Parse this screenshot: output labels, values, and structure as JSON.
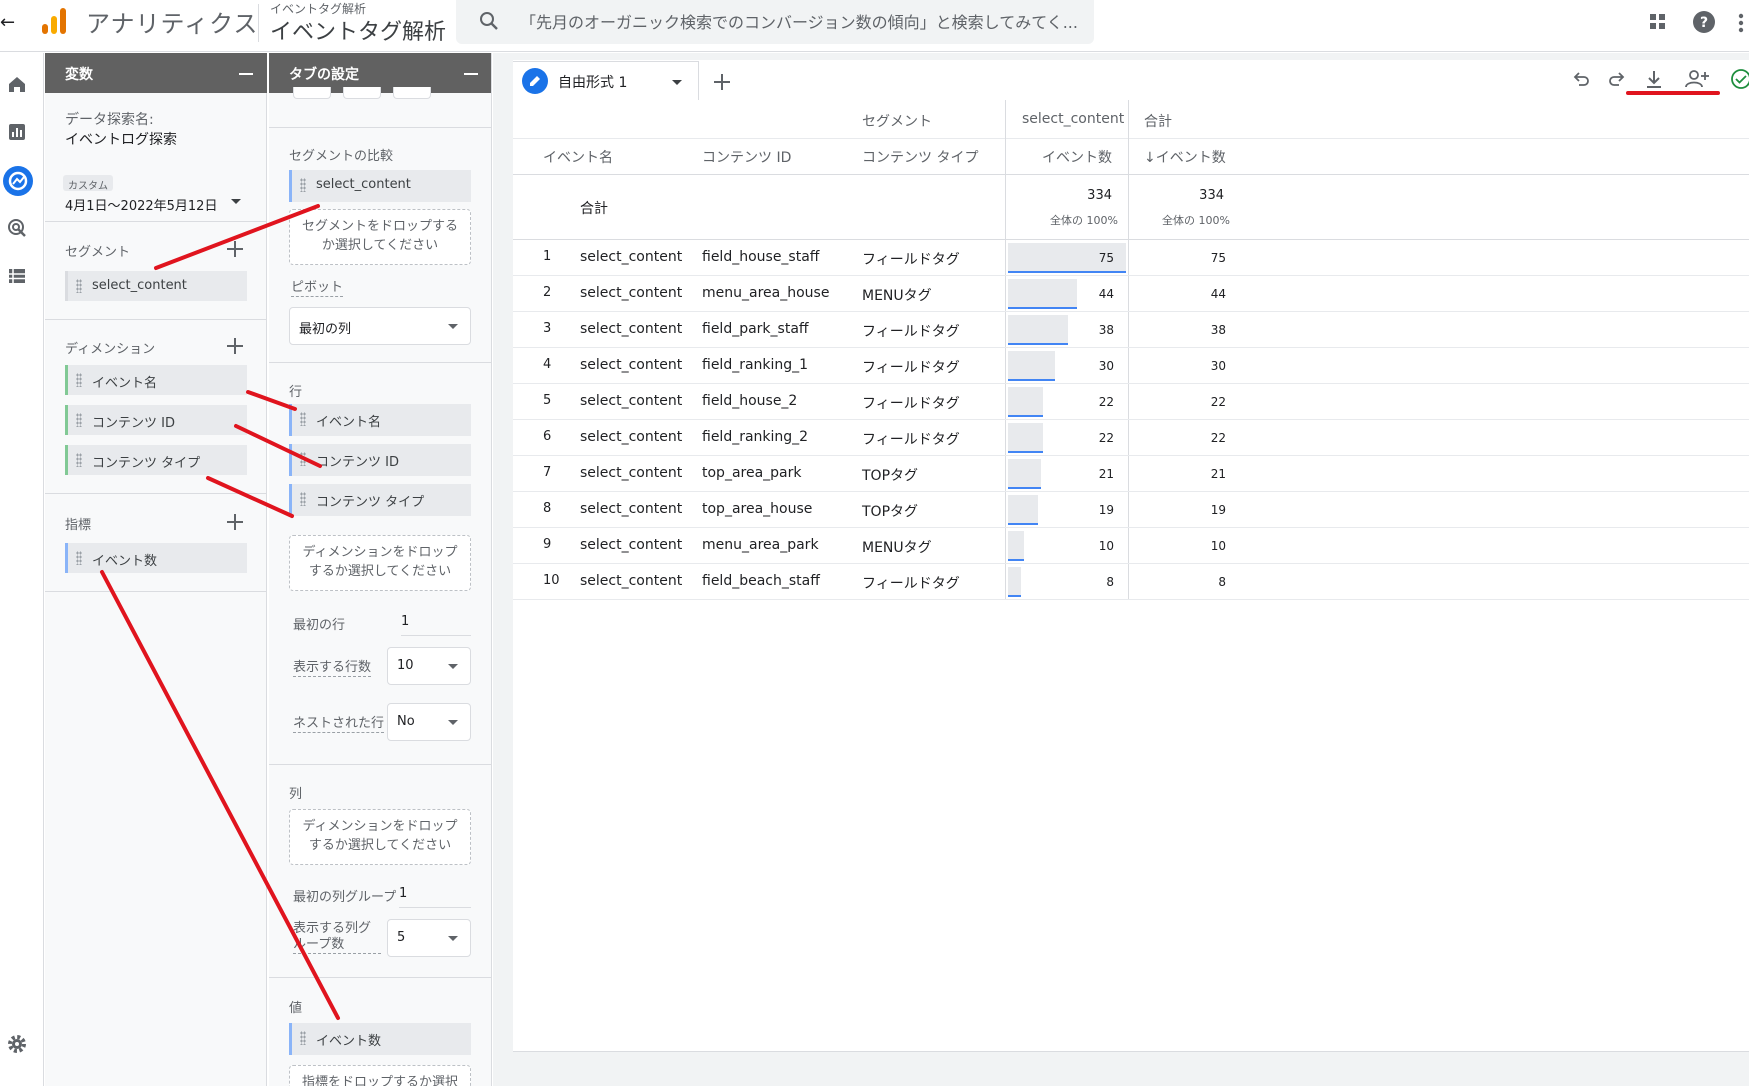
{
  "header": {
    "app_title": "アナリティクス",
    "crumb_small": "イベントタグ解析",
    "crumb_big": "イベントタグ解析",
    "search_placeholder": "「先月のオーガニック検索でのコンバージョン数の傾向」と検索してみてく..."
  },
  "variables": {
    "title": "変数",
    "exploration_label": "データ探索名:",
    "exploration_name": "イベントログ探索",
    "date_tag": "カスタム",
    "date_range": "4月1日～2022年5月12日",
    "segments_label": "セグメント",
    "segments": [
      "select_content"
    ],
    "dimensions_label": "ディメンション",
    "dimensions": [
      "イベント名",
      "コンテンツ ID",
      "コンテンツ タイプ"
    ],
    "metrics_label": "指標",
    "metrics": [
      "イベント数"
    ]
  },
  "tab_settings": {
    "title": "タブの設定",
    "segment_compare_label": "セグメントの比較",
    "segment_chip": "select_content",
    "segment_drop": "セグメントをドロップするか選択してください",
    "pivot_label": "ピボット",
    "pivot_value": "最初の列",
    "rows_label": "行",
    "rows": [
      "イベント名",
      "コンテンツ ID",
      "コンテンツ タイプ"
    ],
    "rows_drop": "ディメンションをドロップするか選択してください",
    "first_row_label": "最初の行",
    "first_row_value": "1",
    "show_rows_label": "表示する行数",
    "show_rows_value": "10",
    "nested_rows_label": "ネストされた行",
    "nested_rows_value": "No",
    "columns_label": "列",
    "columns_drop": "ディメンションをドロップするか選択してください",
    "first_col_group_label": "最初の列グループ",
    "first_col_group_value": "1",
    "show_col_groups_label": "表示する列グループ数",
    "show_col_groups_value": "5",
    "values_label": "値",
    "values_chip": "イベント数",
    "values_drop": "指標をドロップするか選択"
  },
  "canvas": {
    "tab_label": "自由形式 1",
    "header_segment": "セグメント",
    "header_seg_name": "select_content",
    "header_total": "合計",
    "col_event_name": "イベント名",
    "col_content_id": "コンテンツ ID",
    "col_content_type": "コンテンツ タイプ",
    "col_events": "イベント数",
    "col_events_sorted": "↓イベント数",
    "total_label": "合計",
    "total_value": "334",
    "total_value_2": "334",
    "total_pct": "全体の 100%",
    "total_pct_2": "全体の 100%",
    "rows": [
      {
        "n": "1",
        "event": "select_content",
        "id": "field_house_staff",
        "type": "フィールドタグ",
        "v": "75",
        "t": "75",
        "frac": 1.0
      },
      {
        "n": "2",
        "event": "select_content",
        "id": "menu_area_house",
        "type": "MENUタグ",
        "v": "44",
        "t": "44",
        "frac": 0.587
      },
      {
        "n": "3",
        "event": "select_content",
        "id": "field_park_staff",
        "type": "フィールドタグ",
        "v": "38",
        "t": "38",
        "frac": 0.507
      },
      {
        "n": "4",
        "event": "select_content",
        "id": "field_ranking_1",
        "type": "フィールドタグ",
        "v": "30",
        "t": "30",
        "frac": 0.4
      },
      {
        "n": "5",
        "event": "select_content",
        "id": "field_house_2",
        "type": "フィールドタグ",
        "v": "22",
        "t": "22",
        "frac": 0.293
      },
      {
        "n": "6",
        "event": "select_content",
        "id": "field_ranking_2",
        "type": "フィールドタグ",
        "v": "22",
        "t": "22",
        "frac": 0.293
      },
      {
        "n": "7",
        "event": "select_content",
        "id": "top_area_park",
        "type": "TOPタグ",
        "v": "21",
        "t": "21",
        "frac": 0.28
      },
      {
        "n": "8",
        "event": "select_content",
        "id": "top_area_house",
        "type": "TOPタグ",
        "v": "19",
        "t": "19",
        "frac": 0.253
      },
      {
        "n": "9",
        "event": "select_content",
        "id": "menu_area_park",
        "type": "MENUタグ",
        "v": "10",
        "t": "10",
        "frac": 0.133
      },
      {
        "n": "10",
        "event": "select_content",
        "id": "field_beach_staff",
        "type": "フィールドタグ",
        "v": "8",
        "t": "8",
        "frac": 0.107
      }
    ]
  },
  "colors": {
    "accent": "#1a73e8",
    "annotation": "#e0141e",
    "panel_head": "#616161"
  }
}
